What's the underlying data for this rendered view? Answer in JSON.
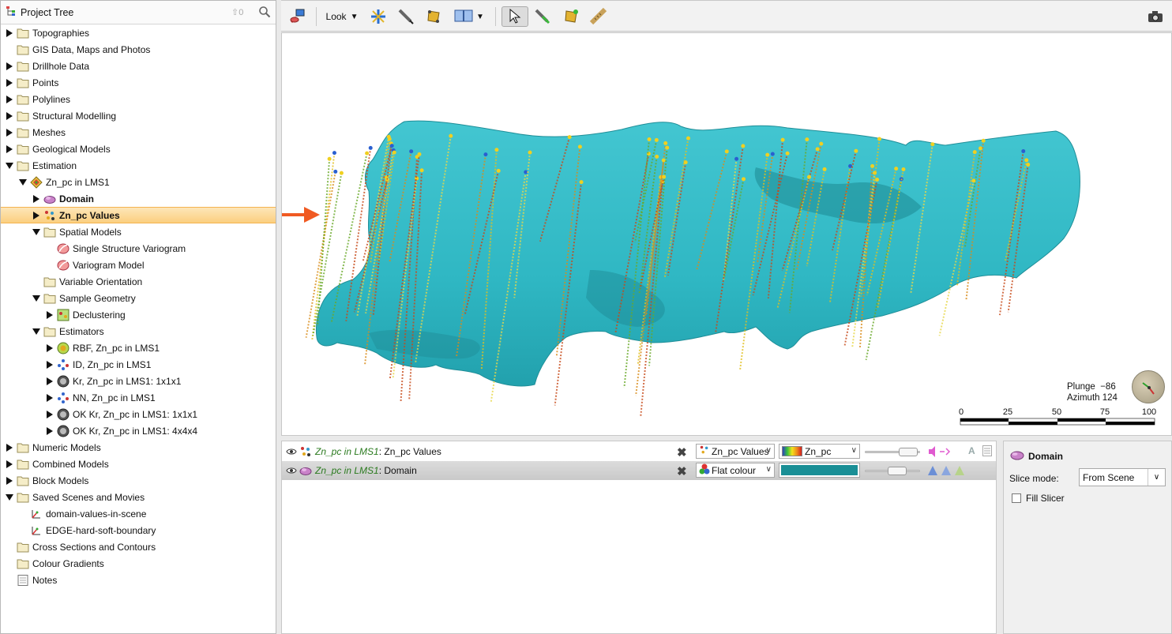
{
  "tree": {
    "title": "Project Tree",
    "up_count": "0",
    "items": [
      {
        "label": "Topographies",
        "level": 0,
        "expander": "collapsed",
        "icon": "folder"
      },
      {
        "label": "GIS Data, Maps and Photos",
        "level": 0,
        "expander": "none",
        "icon": "folder"
      },
      {
        "label": "Drillhole Data",
        "level": 0,
        "expander": "collapsed",
        "icon": "folder"
      },
      {
        "label": "Points",
        "level": 0,
        "expander": "collapsed",
        "icon": "folder"
      },
      {
        "label": "Polylines",
        "level": 0,
        "expander": "collapsed",
        "icon": "folder"
      },
      {
        "label": "Structural Modelling",
        "level": 0,
        "expander": "collapsed",
        "icon": "folder"
      },
      {
        "label": "Meshes",
        "level": 0,
        "expander": "collapsed",
        "icon": "folder"
      },
      {
        "label": "Geological Models",
        "level": 0,
        "expander": "collapsed",
        "icon": "folder"
      },
      {
        "label": "Estimation",
        "level": 0,
        "expander": "expanded",
        "icon": "folder"
      },
      {
        "label": "Zn_pc in LMS1",
        "level": 1,
        "expander": "expanded",
        "icon": "domain-estimation"
      },
      {
        "label": "Domain",
        "level": 2,
        "expander": "collapsed",
        "icon": "domain",
        "bold": true
      },
      {
        "label": "Zn_pc Values",
        "level": 2,
        "expander": "collapsed",
        "icon": "values",
        "bold": true,
        "selected": true
      },
      {
        "label": "Spatial Models",
        "level": 2,
        "expander": "expanded",
        "icon": "folder"
      },
      {
        "label": "Single Structure Variogram",
        "level": 3,
        "expander": "none",
        "icon": "variogram"
      },
      {
        "label": "Variogram Model",
        "level": 3,
        "expander": "none",
        "icon": "variogram"
      },
      {
        "label": "Variable Orientation",
        "level": 2,
        "expander": "none",
        "icon": "folder"
      },
      {
        "label": "Sample Geometry",
        "level": 2,
        "expander": "expanded",
        "icon": "folder"
      },
      {
        "label": "Declustering",
        "level": 3,
        "expander": "collapsed",
        "icon": "declustering"
      },
      {
        "label": "Estimators",
        "level": 2,
        "expander": "expanded",
        "icon": "folder"
      },
      {
        "label": "RBF, Zn_pc in LMS1",
        "level": 3,
        "expander": "collapsed",
        "icon": "rbf"
      },
      {
        "label": "ID, Zn_pc in LMS1",
        "level": 3,
        "expander": "collapsed",
        "icon": "id"
      },
      {
        "label": "Kr, Zn_pc in LMS1: 1x1x1",
        "level": 3,
        "expander": "collapsed",
        "icon": "kriging"
      },
      {
        "label": "NN, Zn_pc in LMS1",
        "level": 3,
        "expander": "collapsed",
        "icon": "id"
      },
      {
        "label": "OK Kr, Zn_pc in LMS1: 1x1x1",
        "level": 3,
        "expander": "collapsed",
        "icon": "kriging"
      },
      {
        "label": "OK Kr, Zn_pc in LMS1: 4x4x4",
        "level": 3,
        "expander": "collapsed",
        "icon": "kriging"
      },
      {
        "label": "Numeric Models",
        "level": 0,
        "expander": "collapsed",
        "icon": "folder"
      },
      {
        "label": "Combined Models",
        "level": 0,
        "expander": "collapsed",
        "icon": "folder"
      },
      {
        "label": "Block Models",
        "level": 0,
        "expander": "collapsed",
        "icon": "folder"
      },
      {
        "label": "Saved Scenes and Movies",
        "level": 0,
        "expander": "expanded",
        "icon": "folder"
      },
      {
        "label": "domain-values-in-scene",
        "level": 1,
        "expander": "none",
        "icon": "scene"
      },
      {
        "label": "EDGE-hard-soft-boundary",
        "level": 1,
        "expander": "none",
        "icon": "scene"
      },
      {
        "label": "Cross Sections and Contours",
        "level": 0,
        "expander": "none",
        "icon": "folder"
      },
      {
        "label": "Colour Gradients",
        "level": 0,
        "expander": "none",
        "icon": "folder"
      },
      {
        "label": "Notes",
        "level": 0,
        "expander": "none",
        "icon": "notes"
      }
    ]
  },
  "toolbar": {
    "look_label": "Look"
  },
  "viewport": {
    "plunge_label": "Plunge",
    "plunge_value": "−86",
    "azimuth_label": "Azimuth",
    "azimuth_value": "124",
    "scale_ticks": [
      "0",
      "25",
      "50",
      "75",
      "100"
    ],
    "colors": {
      "mesh": "#2fb7c3",
      "mesh_dark": "#1f8e98",
      "arrow": "#f05a22"
    }
  },
  "layers": [
    {
      "object": "Zn_pc in LMS1",
      "name": "Zn_pc Values",
      "style": "Zn_pc Values",
      "colour": "Zn_pc",
      "colour_kind": "gradient"
    },
    {
      "object": "Zn_pc in LMS1",
      "name": "Domain",
      "style": "Flat colour",
      "colour": "",
      "colour_kind": "flat",
      "flat_hex": "#1a8f96",
      "selected": true
    }
  ],
  "properties": {
    "title": "Domain",
    "slice_mode_label": "Slice mode:",
    "slice_mode_value": "From Scene",
    "fill_slicer_label": "Fill Slicer",
    "fill_slicer_checked": false
  }
}
